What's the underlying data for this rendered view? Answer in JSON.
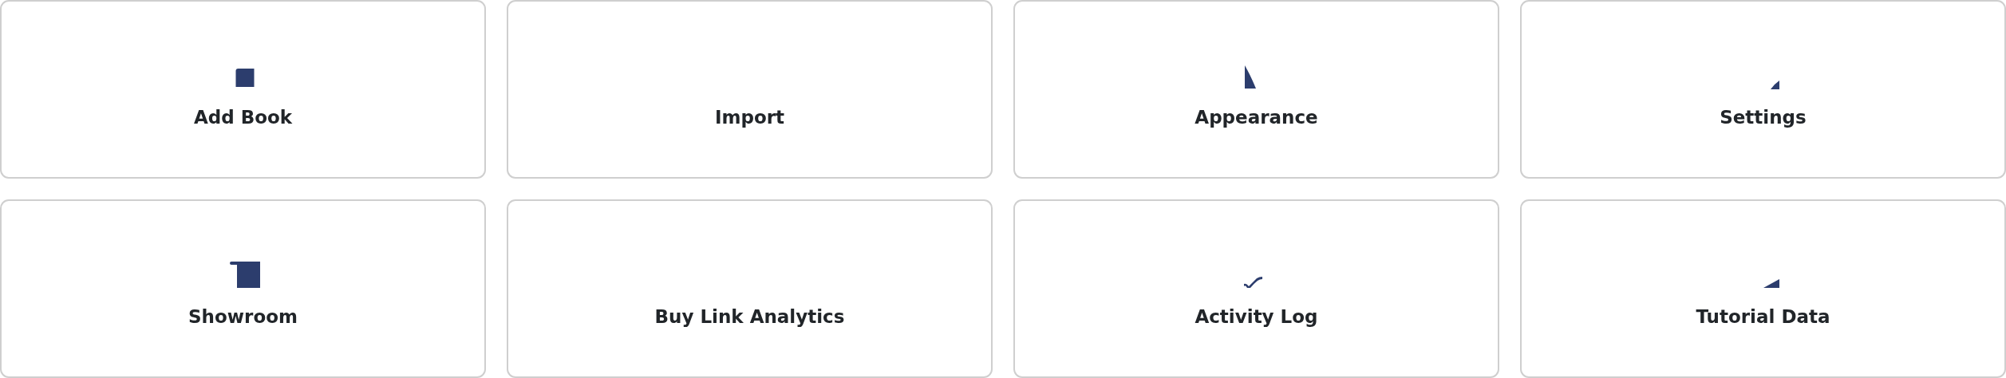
{
  "tiles": [
    {
      "label": "Add Book"
    },
    {
      "label": "Import"
    },
    {
      "label": "Appearance"
    },
    {
      "label": "Settings"
    },
    {
      "label": "Showroom"
    },
    {
      "label": "Buy Link Analytics"
    },
    {
      "label": "Activity Log"
    },
    {
      "label": "Tutorial Data"
    }
  ]
}
